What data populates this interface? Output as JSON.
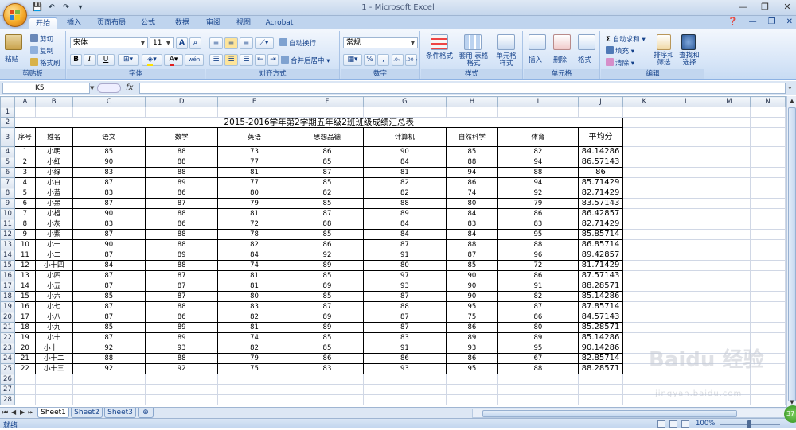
{
  "window": {
    "title": "1 - Microsoft Excel"
  },
  "quick_access": [
    {
      "icon": "save-icon",
      "glyph": "💾"
    },
    {
      "icon": "undo-icon",
      "glyph": "↶"
    },
    {
      "icon": "redo-icon",
      "glyph": "↷"
    },
    {
      "icon": "customize-icon",
      "glyph": "▾"
    }
  ],
  "tabs": [
    "开始",
    "插入",
    "页面布局",
    "公式",
    "数据",
    "审阅",
    "视图",
    "Acrobat"
  ],
  "ribbon": {
    "clipboard": {
      "label": "剪贴板",
      "paste": "粘贴",
      "cut": "剪切",
      "copy": "复制",
      "format_painter": "格式刷"
    },
    "font": {
      "label": "字体",
      "name": "宋体",
      "size": "11",
      "bold": "B",
      "italic": "I",
      "underline": "U",
      "grow": "A",
      "shrink": "A",
      "font_color": "A",
      "phonetic": "wén"
    },
    "alignment": {
      "label": "对齐方式",
      "wrap_text": "自动换行",
      "merge_center": "合并后居中"
    },
    "number": {
      "label": "数字",
      "format": "常规",
      "percent": "%",
      "comma": ","
    },
    "styles": {
      "label": "样式",
      "conditional": "条件格式",
      "table_format": "套用 表格格式",
      "cell_styles": "单元格 样式"
    },
    "cells": {
      "label": "单元格",
      "insert": "插入",
      "delete": "删除",
      "format": "格式"
    },
    "editing": {
      "label": "编辑",
      "autosum": "自动求和",
      "fill": "填充",
      "clear": "清除",
      "sort_filter": "排序和 筛选",
      "find_select": "查找和 选择"
    }
  },
  "formula_bar": {
    "name_box": "K5",
    "fx": "fx",
    "value": ""
  },
  "columns": [
    "A",
    "B",
    "C",
    "D",
    "E",
    "F",
    "G",
    "H",
    "I",
    "J",
    "K",
    "L",
    "M",
    "N"
  ],
  "sheet": {
    "title": "2015-2016学年第2学期五年级2班班级成绩汇总表",
    "headers": [
      "序号",
      "姓名",
      "语文",
      "数学",
      "英语",
      "思想品德",
      "计算机",
      "自然科学",
      "体育",
      "平均分"
    ],
    "rows": [
      [
        "1",
        "小明",
        "85",
        "88",
        "73",
        "86",
        "90",
        "85",
        "82",
        "84.14286"
      ],
      [
        "2",
        "小红",
        "90",
        "88",
        "77",
        "85",
        "84",
        "88",
        "94",
        "86.57143"
      ],
      [
        "3",
        "小绿",
        "83",
        "88",
        "81",
        "87",
        "81",
        "94",
        "88",
        "86"
      ],
      [
        "4",
        "小白",
        "87",
        "89",
        "77",
        "85",
        "82",
        "86",
        "94",
        "85.71429"
      ],
      [
        "5",
        "小蓝",
        "83",
        "86",
        "80",
        "82",
        "82",
        "74",
        "92",
        "82.71429"
      ],
      [
        "6",
        "小黑",
        "87",
        "87",
        "79",
        "85",
        "88",
        "80",
        "79",
        "83.57143"
      ],
      [
        "7",
        "小橙",
        "90",
        "88",
        "81",
        "87",
        "89",
        "84",
        "86",
        "86.42857"
      ],
      [
        "8",
        "小灰",
        "83",
        "86",
        "72",
        "88",
        "84",
        "83",
        "83",
        "82.71429"
      ],
      [
        "9",
        "小紫",
        "87",
        "88",
        "78",
        "85",
        "84",
        "84",
        "95",
        "85.85714"
      ],
      [
        "10",
        "小一",
        "90",
        "88",
        "82",
        "86",
        "87",
        "88",
        "88",
        "86.85714"
      ],
      [
        "11",
        "小二",
        "87",
        "89",
        "84",
        "92",
        "91",
        "87",
        "96",
        "89.42857"
      ],
      [
        "12",
        "小十四",
        "84",
        "88",
        "74",
        "89",
        "80",
        "85",
        "72",
        "81.71429"
      ],
      [
        "13",
        "小四",
        "87",
        "87",
        "81",
        "85",
        "97",
        "90",
        "86",
        "87.57143"
      ],
      [
        "14",
        "小五",
        "87",
        "87",
        "81",
        "89",
        "93",
        "90",
        "91",
        "88.28571"
      ],
      [
        "15",
        "小六",
        "85",
        "87",
        "80",
        "85",
        "87",
        "90",
        "82",
        "85.14286"
      ],
      [
        "16",
        "小七",
        "87",
        "88",
        "83",
        "87",
        "88",
        "95",
        "87",
        "87.85714"
      ],
      [
        "17",
        "小八",
        "87",
        "86",
        "82",
        "89",
        "87",
        "75",
        "86",
        "84.57143"
      ],
      [
        "18",
        "小九",
        "85",
        "89",
        "81",
        "89",
        "87",
        "86",
        "80",
        "85.28571"
      ],
      [
        "19",
        "小十",
        "87",
        "89",
        "74",
        "85",
        "83",
        "89",
        "89",
        "85.14286"
      ],
      [
        "20",
        "小十一",
        "92",
        "93",
        "82",
        "85",
        "91",
        "93",
        "95",
        "90.14286"
      ],
      [
        "21",
        "小十二",
        "88",
        "88",
        "79",
        "86",
        "86",
        "86",
        "67",
        "82.85714"
      ],
      [
        "22",
        "小十三",
        "92",
        "92",
        "75",
        "83",
        "93",
        "95",
        "88",
        "88.28571"
      ]
    ],
    "empty_rows": [
      "26",
      "27",
      "28"
    ]
  },
  "sheet_tabs": [
    "Sheet1",
    "Sheet2",
    "Sheet3"
  ],
  "status": {
    "ready": "就绪",
    "zoom": "100%",
    "zoom_level_percent": 100
  },
  "watermark": {
    "brand": "Baidu 经验",
    "url": "jingyan.baidu.com"
  },
  "badge": "37"
}
